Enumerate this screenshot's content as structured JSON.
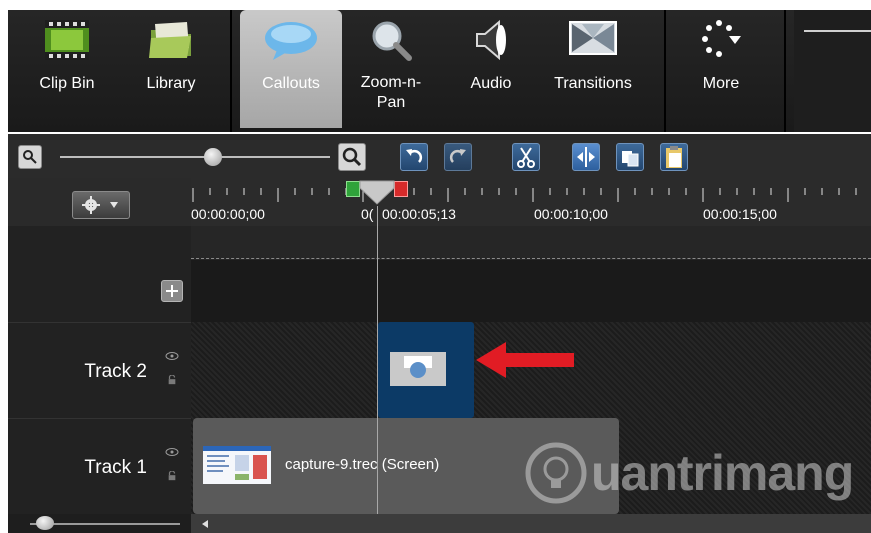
{
  "toolbar": {
    "tools": [
      {
        "label": "Clip Bin",
        "icon": "clip-bin-icon"
      },
      {
        "label": "Library",
        "icon": "library-icon"
      },
      {
        "label": "Callouts",
        "icon": "callouts-icon",
        "selected": true
      },
      {
        "label": "Zoom-n-Pan",
        "label_line1": "Zoom-n-",
        "label_line2": "Pan",
        "icon": "magnifier-icon"
      },
      {
        "label": "Audio",
        "icon": "speaker-icon"
      },
      {
        "label": "Transitions",
        "icon": "transitions-icon"
      },
      {
        "label": "More",
        "icon": "more-icon"
      }
    ]
  },
  "editbar": {
    "icons": [
      "zoom-out-icon",
      "zoom-slider",
      "zoom-in-icon",
      "undo-icon",
      "redo-icon",
      "cut-icon",
      "split-icon",
      "copy-icon",
      "paste-icon"
    ]
  },
  "ruler": {
    "settings_icon": "gear-icon",
    "ticks": [
      "00:00:00;00",
      "0(",
      "00:00:05;13",
      "00:00:10;00",
      "00:00:15;00"
    ]
  },
  "tracks": [
    {
      "name": "Track 2",
      "clip_icon": "callout-clip-icon"
    },
    {
      "name": "Track 1",
      "clip_label": "capture-9.trec (Screen)"
    }
  ],
  "watermark": {
    "text": "uantrimang"
  },
  "colors": {
    "selected_clip": "#0c3a66",
    "arrow": "#e11c24",
    "ruler_marker_in": "#2fa33a",
    "ruler_marker_out": "#d62a2a"
  }
}
